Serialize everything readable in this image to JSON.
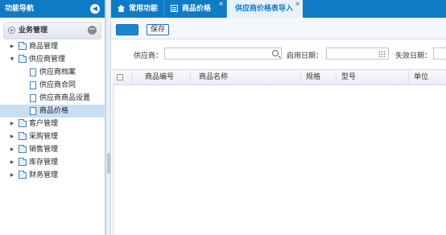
{
  "sidebar": {
    "title": "功能导航",
    "section": "业务管理",
    "tree": [
      {
        "label": "商品管理",
        "level": 1,
        "expanded": false
      },
      {
        "label": "供应商管理",
        "level": 1,
        "expanded": true
      },
      {
        "label": "供应商档案",
        "level": 2
      },
      {
        "label": "供应商合同",
        "level": 2
      },
      {
        "label": "供应商商品设置",
        "level": 2
      },
      {
        "label": "商品价格",
        "level": 2,
        "selected": true
      },
      {
        "label": "客户管理",
        "level": 1,
        "expanded": false
      },
      {
        "label": "采购管理",
        "level": 1,
        "expanded": false
      },
      {
        "label": "销售管理",
        "level": 1,
        "expanded": false
      },
      {
        "label": "库存管理",
        "level": 1,
        "expanded": false
      },
      {
        "label": "财务管理",
        "level": 1,
        "expanded": false
      }
    ]
  },
  "tabs": [
    {
      "label": "常用功能",
      "icon": "home-icon"
    },
    {
      "label": "商品价格",
      "icon": "document-icon"
    },
    {
      "label": "供应商价格表导入",
      "active": true
    }
  ],
  "toolbar": {
    "save_label": "保存"
  },
  "filters": {
    "supplier_label": "供应商：",
    "start_date_label": "启用日期：",
    "end_date_label": "失效日期："
  },
  "grid": {
    "columns": [
      "商品编号",
      "商品名称",
      "规格",
      "型号",
      "单位"
    ]
  },
  "colors": {
    "header_blue": "#0f7bc4",
    "selected_row": "#c7dff3"
  }
}
